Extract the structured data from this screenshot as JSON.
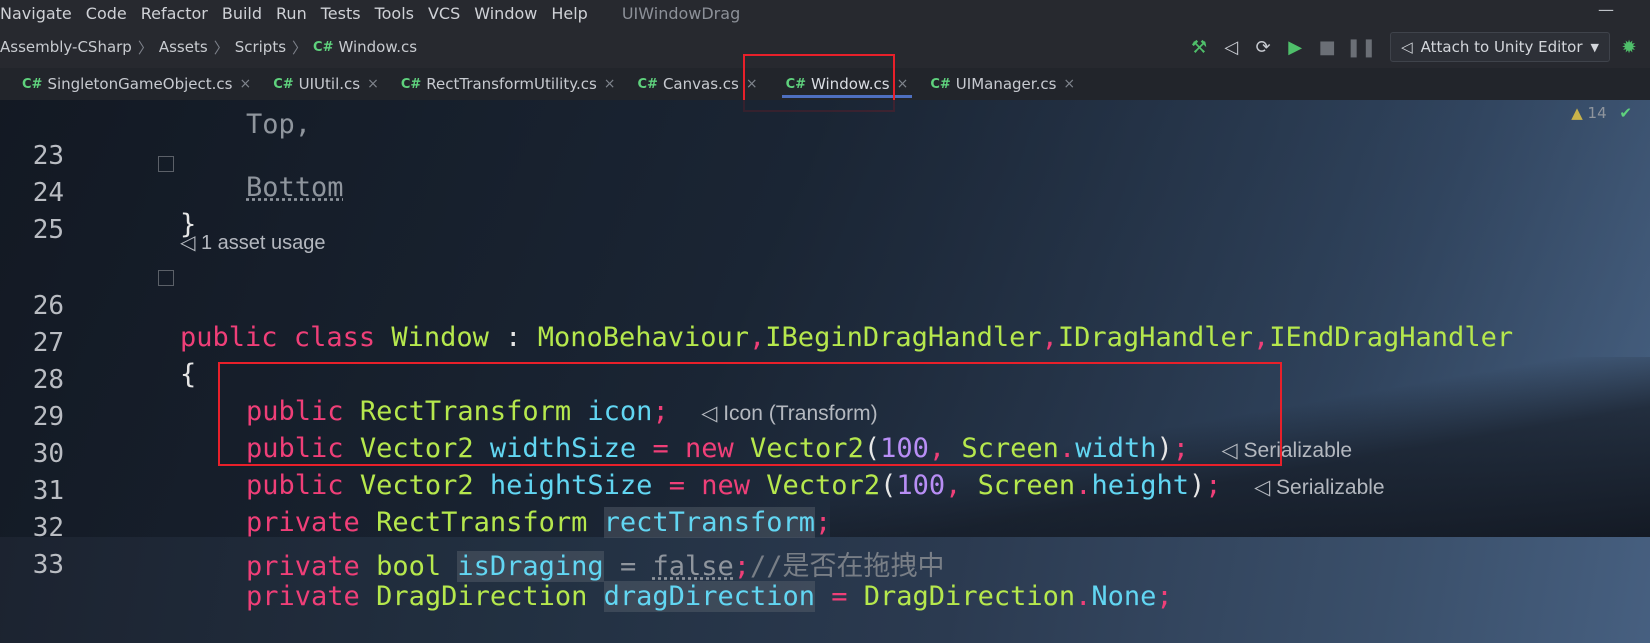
{
  "menubar": {
    "items": [
      "Navigate",
      "Code",
      "Refactor",
      "Build",
      "Run",
      "Tests",
      "Tools",
      "VCS",
      "Window",
      "Help"
    ],
    "window_title": "UIWindowDrag",
    "minimize_glyph": "—"
  },
  "breadcrumb": {
    "items": [
      "Assembly-CSharp",
      "Assets",
      "Scripts",
      "Window.cs"
    ],
    "file_tag": "C#"
  },
  "toolbar": {
    "attach_label": "Attach to Unity Editor",
    "icons": [
      "hammer-icon",
      "unity-icon",
      "unity-refresh-icon",
      "play-icon",
      "stop-icon",
      "pause-icon",
      "bug-icon"
    ]
  },
  "tabs": [
    {
      "tag": "C#",
      "label": "SingletonGameObject.cs",
      "close": "×"
    },
    {
      "tag": "C#",
      "label": "UIUtil.cs",
      "close": "×"
    },
    {
      "tag": "C#",
      "label": "RectTransformUtility.cs",
      "close": "×"
    },
    {
      "tag": "C#",
      "label": "Canvas.cs",
      "close": "×"
    },
    {
      "tag": "C#",
      "label": "Window.cs",
      "close": "×"
    },
    {
      "tag": "C#",
      "label": "UIManager.cs",
      "close": "×"
    }
  ],
  "active_tab_index": 4,
  "inspections": {
    "warning_count": "14",
    "warning_glyph": "▲",
    "ok_glyph": "✔"
  },
  "editor": {
    "lines": [
      {
        "n": "23",
        "text": "Bottom"
      },
      {
        "n": "24",
        "text": "}"
      },
      {
        "n": "25",
        "text": ""
      },
      {
        "n": "26",
        "text": "public class Window : MonoBehaviour,IBeginDragHandler,IDragHandler,IEndDragHandler"
      },
      {
        "n": "27",
        "text": "{"
      },
      {
        "n": "28",
        "text": "public RectTransform icon;"
      },
      {
        "n": "29",
        "text": "public Vector2 widthSize = new Vector2(100, Screen.width);"
      },
      {
        "n": "30",
        "text": "public Vector2 heightSize = new Vector2(100, Screen.height);"
      },
      {
        "n": "31",
        "text": "private RectTransform rectTransform;"
      },
      {
        "n": "32",
        "text": "private bool isDraging = false;//是否在拖拽中"
      }
    ],
    "usage_hint": "1 asset usage",
    "hint_line28": "Icon (Transform)",
    "hint_line29": "Serializable",
    "hint_line30": "Serializable",
    "colors": {
      "keyword": "#ef3f78",
      "type": "#b6e84d",
      "field": "#62d6f2",
      "number": "#b88ef5",
      "comment": "#787e86",
      "highlight_box": "#e8202a"
    }
  }
}
